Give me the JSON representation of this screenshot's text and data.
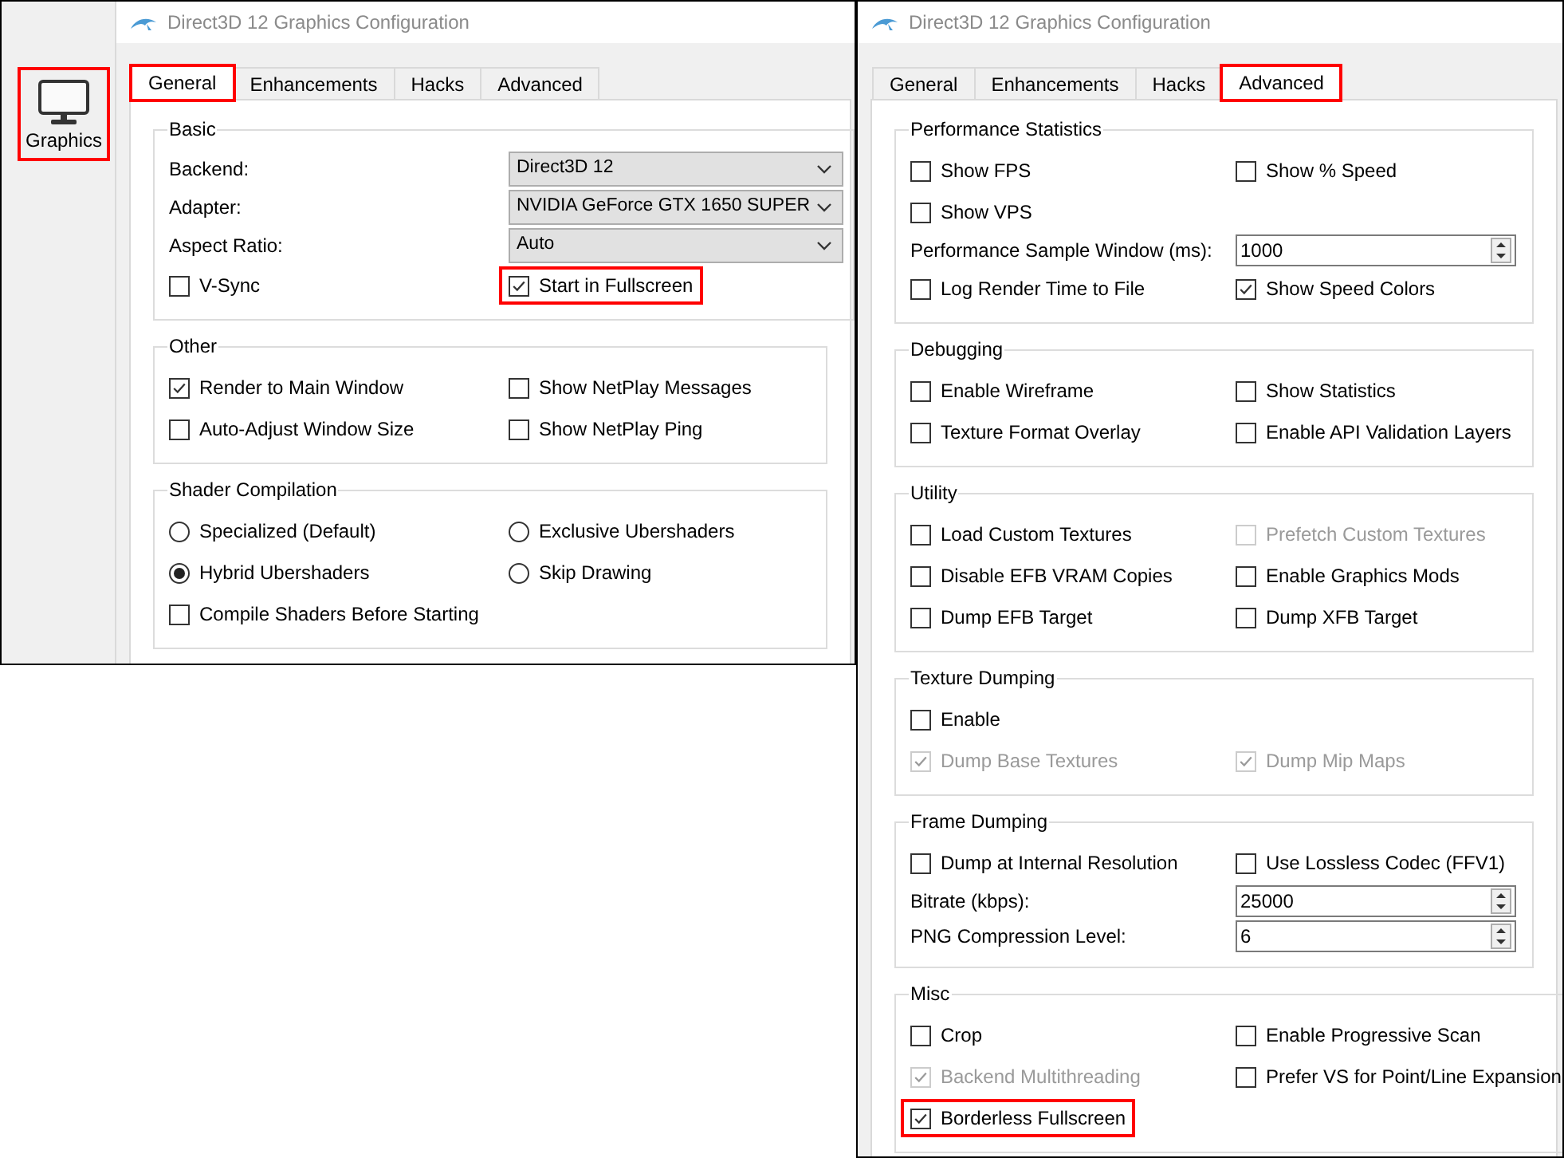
{
  "sidebar": {
    "items": [
      {
        "label": "Graphics",
        "highlighted": true
      }
    ]
  },
  "windows": [
    {
      "title": "Direct3D 12 Graphics Configuration",
      "tabs": [
        {
          "label": "General",
          "selected": true,
          "highlighted": true
        },
        {
          "label": "Enhancements",
          "selected": false,
          "highlighted": false
        },
        {
          "label": "Hacks",
          "selected": false,
          "highlighted": false
        },
        {
          "label": "Advanced",
          "selected": false,
          "highlighted": false
        }
      ],
      "groups": [
        {
          "title": "Basic",
          "rows": [
            [
              {
                "kind": "dropdown",
                "label": "Backend:",
                "value": "Direct3D 12"
              }
            ],
            [
              {
                "kind": "dropdown",
                "label": "Adapter:",
                "value": "NVIDIA GeForce GTX 1650 SUPER"
              }
            ],
            [
              {
                "kind": "dropdown",
                "label": "Aspect Ratio:",
                "value": "Auto"
              }
            ],
            [
              {
                "kind": "checkbox",
                "label": "V-Sync",
                "checked": false,
                "disabled": false,
                "highlighted": false
              },
              {
                "kind": "checkbox",
                "label": "Start in Fullscreen",
                "checked": true,
                "disabled": false,
                "highlighted": true
              }
            ]
          ]
        },
        {
          "title": "Other",
          "rows": [
            [
              {
                "kind": "checkbox",
                "label": "Render to Main Window",
                "checked": true,
                "disabled": false,
                "highlighted": false
              },
              {
                "kind": "checkbox",
                "label": "Show NetPlay Messages",
                "checked": false,
                "disabled": false,
                "highlighted": false
              }
            ],
            [
              {
                "kind": "checkbox",
                "label": "Auto-Adjust Window Size",
                "checked": false,
                "disabled": false,
                "highlighted": false
              },
              {
                "kind": "checkbox",
                "label": "Show NetPlay Ping",
                "checked": false,
                "disabled": false,
                "highlighted": false
              }
            ]
          ]
        },
        {
          "title": "Shader Compilation",
          "rows": [
            [
              {
                "kind": "radio",
                "label": "Specialized (Default)",
                "selected": false
              },
              {
                "kind": "radio",
                "label": "Exclusive Ubershaders",
                "selected": false
              }
            ],
            [
              {
                "kind": "radio",
                "label": "Hybrid Ubershaders",
                "selected": true
              },
              {
                "kind": "radio",
                "label": "Skip Drawing",
                "selected": false
              }
            ],
            [
              {
                "kind": "checkbox",
                "label": "Compile Shaders Before Starting",
                "checked": false,
                "disabled": false,
                "highlighted": false
              }
            ]
          ]
        }
      ]
    },
    {
      "title": "Direct3D 12 Graphics Configuration",
      "tabs": [
        {
          "label": "General",
          "selected": false,
          "highlighted": false
        },
        {
          "label": "Enhancements",
          "selected": false,
          "highlighted": false
        },
        {
          "label": "Hacks",
          "selected": false,
          "highlighted": false
        },
        {
          "label": "Advanced",
          "selected": true,
          "highlighted": true
        }
      ],
      "groups": [
        {
          "title": "Performance Statistics",
          "rows": [
            [
              {
                "kind": "checkbox",
                "label": "Show FPS",
                "checked": false,
                "disabled": false,
                "highlighted": false
              },
              {
                "kind": "checkbox",
                "label": "Show % Speed",
                "checked": false,
                "disabled": false,
                "highlighted": false
              }
            ],
            [
              {
                "kind": "checkbox",
                "label": "Show VPS",
                "checked": false,
                "disabled": false,
                "highlighted": false
              }
            ],
            [
              {
                "kind": "spinbox",
                "label": "Performance Sample Window (ms):",
                "value": "1000"
              }
            ],
            [
              {
                "kind": "checkbox",
                "label": "Log Render Time to File",
                "checked": false,
                "disabled": false,
                "highlighted": false
              },
              {
                "kind": "checkbox",
                "label": "Show Speed Colors",
                "checked": true,
                "disabled": false,
                "highlighted": false
              }
            ]
          ]
        },
        {
          "title": "Debugging",
          "rows": [
            [
              {
                "kind": "checkbox",
                "label": "Enable Wireframe",
                "checked": false,
                "disabled": false,
                "highlighted": false
              },
              {
                "kind": "checkbox",
                "label": "Show Statistics",
                "checked": false,
                "disabled": false,
                "highlighted": false
              }
            ],
            [
              {
                "kind": "checkbox",
                "label": "Texture Format Overlay",
                "checked": false,
                "disabled": false,
                "highlighted": false
              },
              {
                "kind": "checkbox",
                "label": "Enable API Validation Layers",
                "checked": false,
                "disabled": false,
                "highlighted": false
              }
            ]
          ]
        },
        {
          "title": "Utility",
          "rows": [
            [
              {
                "kind": "checkbox",
                "label": "Load Custom Textures",
                "checked": false,
                "disabled": false,
                "highlighted": false
              },
              {
                "kind": "checkbox",
                "label": "Prefetch Custom Textures",
                "checked": false,
                "disabled": true,
                "highlighted": false
              }
            ],
            [
              {
                "kind": "checkbox",
                "label": "Disable EFB VRAM Copies",
                "checked": false,
                "disabled": false,
                "highlighted": false
              },
              {
                "kind": "checkbox",
                "label": "Enable Graphics Mods",
                "checked": false,
                "disabled": false,
                "highlighted": false
              }
            ],
            [
              {
                "kind": "checkbox",
                "label": "Dump EFB Target",
                "checked": false,
                "disabled": false,
                "highlighted": false
              },
              {
                "kind": "checkbox",
                "label": "Dump XFB Target",
                "checked": false,
                "disabled": false,
                "highlighted": false
              }
            ]
          ]
        },
        {
          "title": "Texture Dumping",
          "rows": [
            [
              {
                "kind": "checkbox",
                "label": "Enable",
                "checked": false,
                "disabled": false,
                "highlighted": false
              }
            ],
            [
              {
                "kind": "checkbox",
                "label": "Dump Base Textures",
                "checked": true,
                "disabled": true,
                "highlighted": false
              },
              {
                "kind": "checkbox",
                "label": "Dump Mip Maps",
                "checked": true,
                "disabled": true,
                "highlighted": false
              }
            ]
          ]
        },
        {
          "title": "Frame Dumping",
          "rows": [
            [
              {
                "kind": "checkbox",
                "label": "Dump at Internal Resolution",
                "checked": false,
                "disabled": false,
                "highlighted": false
              },
              {
                "kind": "checkbox",
                "label": "Use Lossless Codec (FFV1)",
                "checked": false,
                "disabled": false,
                "highlighted": false
              }
            ],
            [
              {
                "kind": "spinbox",
                "label": "Bitrate (kbps):",
                "value": "25000"
              }
            ],
            [
              {
                "kind": "spinbox",
                "label": "PNG Compression Level:",
                "value": "6"
              }
            ]
          ]
        },
        {
          "title": "Misc",
          "rows": [
            [
              {
                "kind": "checkbox",
                "label": "Crop",
                "checked": false,
                "disabled": false,
                "highlighted": false
              },
              {
                "kind": "checkbox",
                "label": "Enable Progressive Scan",
                "checked": false,
                "disabled": false,
                "highlighted": false
              }
            ],
            [
              {
                "kind": "checkbox",
                "label": "Backend Multithreading",
                "checked": true,
                "disabled": true,
                "highlighted": false
              },
              {
                "kind": "checkbox",
                "label": "Prefer VS for Point/Line Expansion",
                "checked": false,
                "disabled": false,
                "highlighted": false
              }
            ],
            [
              {
                "kind": "checkbox",
                "label": "Borderless Fullscreen",
                "checked": true,
                "disabled": false,
                "highlighted": true
              }
            ]
          ]
        }
      ]
    }
  ]
}
